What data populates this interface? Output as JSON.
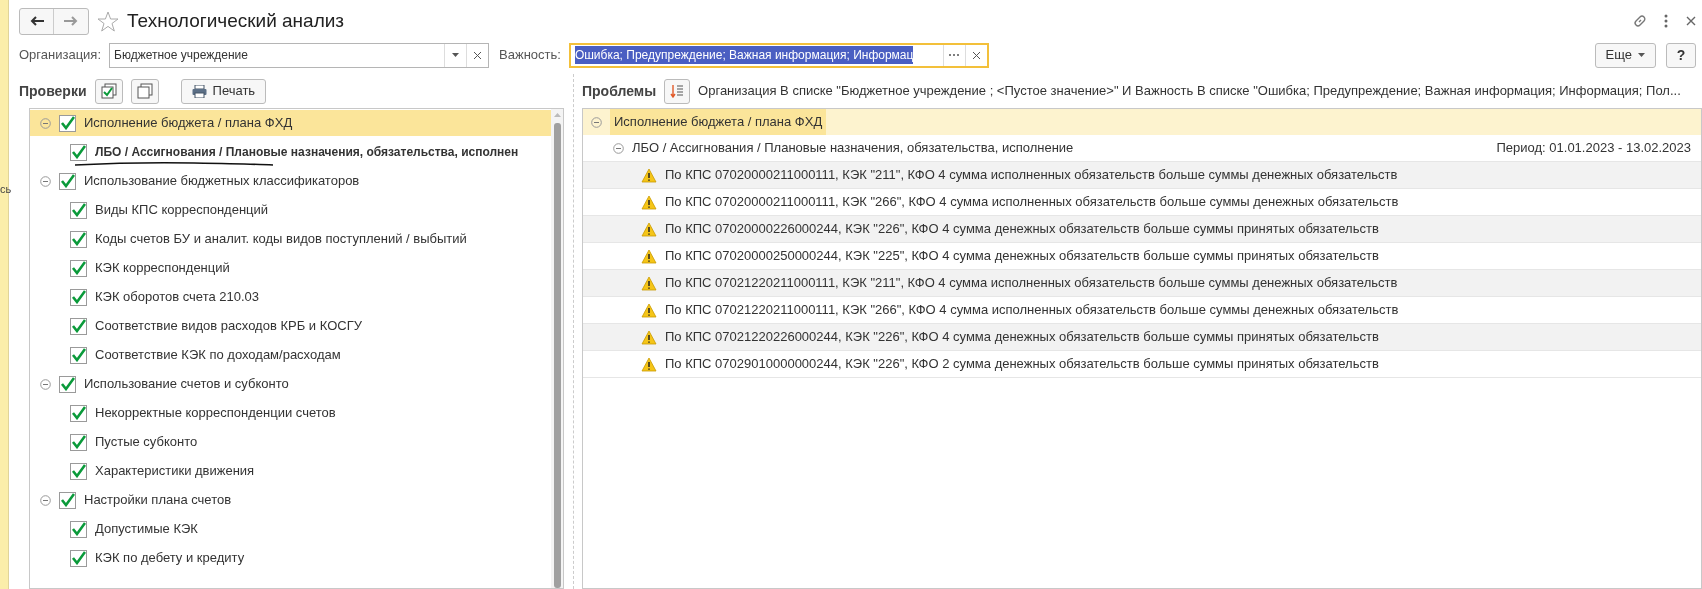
{
  "side_fragment": "сь",
  "window": {
    "title": "Технологический анализ",
    "favorite": false
  },
  "filters": [
    {
      "label": "Организация:",
      "value": "Бюджетное учреждение",
      "kind": "dropdown",
      "focused": false
    },
    {
      "label": "Важность:",
      "value": "Ошибка; Предупреждение; Важная информация; Информац",
      "kind": "choice",
      "focused": true
    }
  ],
  "more_button": "Еще",
  "help_button": "?",
  "checks": {
    "title": "Проверки",
    "print_button": "Печать",
    "tree": [
      {
        "label": "Исполнение бюджета / плана ФХД",
        "checked": true,
        "selected": true,
        "expanded": true,
        "children": [
          {
            "label": "ЛБО / Ассигнования / Плановые назначения, обязательства, исполнен",
            "checked": true,
            "bold": true,
            "underlined": true
          }
        ]
      },
      {
        "label": "Использование бюджетных классификаторов",
        "checked": true,
        "selected": false,
        "expanded": true,
        "children": [
          {
            "label": "Виды КПС корреспонденций",
            "checked": true,
            "bold": false,
            "underlined": false
          },
          {
            "label": "Коды счетов БУ и аналит. коды видов поступлений / выбытий",
            "checked": true,
            "bold": false,
            "underlined": false
          },
          {
            "label": "КЭК корреспонденций",
            "checked": true,
            "bold": false,
            "underlined": false
          },
          {
            "label": "КЭК оборотов счета 210.03",
            "checked": true,
            "bold": false,
            "underlined": false
          },
          {
            "label": "Соответствие видов расходов КРБ и КОСГУ",
            "checked": true,
            "bold": false,
            "underlined": false
          },
          {
            "label": "Соответствие КЭК по доходам/расходам",
            "checked": true,
            "bold": false,
            "underlined": false
          }
        ]
      },
      {
        "label": "Использование счетов и субконто",
        "checked": true,
        "selected": false,
        "expanded": true,
        "children": [
          {
            "label": "Некорректные корреспонденции счетов",
            "checked": true,
            "bold": false,
            "underlined": false
          },
          {
            "label": "Пустые субконто",
            "checked": true,
            "bold": false,
            "underlined": false
          },
          {
            "label": "Характеристики движения",
            "checked": true,
            "bold": false,
            "underlined": false
          }
        ]
      },
      {
        "label": "Настройки плана счетов",
        "checked": true,
        "selected": false,
        "expanded": true,
        "children": [
          {
            "label": "Допустимые КЭК",
            "checked": true,
            "bold": false,
            "underlined": false
          },
          {
            "label": "КЭК по дебету и кредиту",
            "checked": true,
            "bold": false,
            "underlined": false
          }
        ]
      }
    ]
  },
  "problems": {
    "title": "Проблемы",
    "filter_text": "Организация В списке \"Бюджетное учреждение ; <Пустое значение>\" И Важность В списке \"Ошибка; Предупреждение; Важная информация; Информация; Пол...",
    "group": {
      "label": "Исполнение бюджета / плана ФХД",
      "expanded": true
    },
    "subgroup": {
      "label": "ЛБО / Ассигнования / Плановые назначения, обязательства, исполнение",
      "period": "Период: 01.01.2023 - 13.02.2023",
      "expanded": true
    },
    "rows": [
      {
        "kind": "warning",
        "text": "По КПС 07020000211000111, КЭК \"211\", КФО 4 сумма исполненных обязательств больше суммы денежных обязательств"
      },
      {
        "kind": "warning",
        "text": "По КПС 07020000211000111, КЭК \"266\", КФО 4 сумма исполненных обязательств больше суммы денежных обязательств"
      },
      {
        "kind": "warning",
        "text": "По КПС 07020000226000244, КЭК \"226\", КФО 4 сумма денежных обязательств больше суммы принятых обязательств"
      },
      {
        "kind": "warning",
        "text": "По КПС 07020000250000244, КЭК \"225\", КФО 4 сумма денежных обязательств больше суммы принятых обязательств"
      },
      {
        "kind": "warning",
        "text": "По КПС 07021220211000111, КЭК \"211\", КФО 4 сумма исполненных обязательств больше суммы денежных обязательств"
      },
      {
        "kind": "warning",
        "text": "По КПС 07021220211000111, КЭК \"266\", КФО 4 сумма исполненных обязательств больше суммы денежных обязательств"
      },
      {
        "kind": "warning",
        "text": "По КПС 07021220226000244, КЭК \"226\", КФО 4 сумма денежных обязательств больше суммы принятых обязательств"
      },
      {
        "kind": "warning",
        "text": "По КПС 07029010000000244, КЭК \"226\", КФО 2 сумма денежных обязательств больше суммы принятых обязательств"
      }
    ]
  }
}
